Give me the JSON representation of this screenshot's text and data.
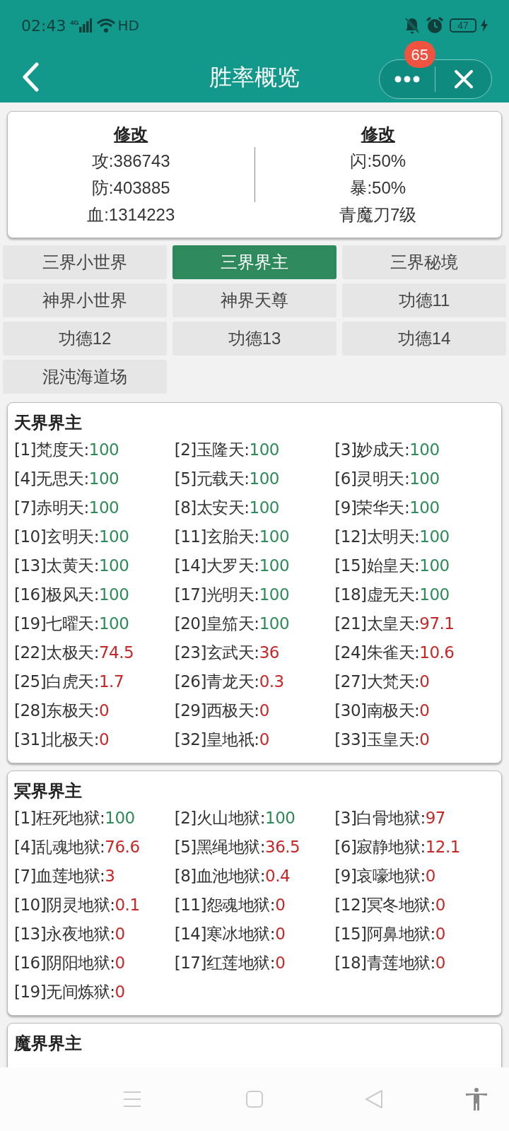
{
  "status_bar": {
    "time": "02:43",
    "network": "4G",
    "wifi_label": "HD",
    "battery": "47"
  },
  "header": {
    "title": "胜率概览",
    "badge": "65"
  },
  "stats": [
    {
      "link": "修改",
      "lines": [
        "攻:386743",
        "防:403885",
        "血:1314223"
      ]
    },
    {
      "link": "修改",
      "lines": [
        "闪:50%",
        "暴:50%",
        "青魔刀7级"
      ]
    }
  ],
  "tabs": [
    {
      "label": "三界小世界",
      "selected": false
    },
    {
      "label": "三界界主",
      "selected": true
    },
    {
      "label": "三界秘境",
      "selected": false
    },
    {
      "label": "神界小世界",
      "selected": false
    },
    {
      "label": "神界天尊",
      "selected": false
    },
    {
      "label": "功德11",
      "selected": false
    },
    {
      "label": "功德12",
      "selected": false
    },
    {
      "label": "功德13",
      "selected": false
    },
    {
      "label": "功德14",
      "selected": false
    },
    {
      "label": "混沌海道场",
      "selected": false
    }
  ],
  "sections": [
    {
      "title": "天界界主",
      "items": [
        {
          "label": "[1]梵度天:",
          "value": "100",
          "color": "#2e8b57"
        },
        {
          "label": "[2]玉隆天:",
          "value": "100",
          "color": "#2e8b57"
        },
        {
          "label": "[3]妙成天:",
          "value": "100",
          "color": "#2e8b57"
        },
        {
          "label": "[4]无思天:",
          "value": "100",
          "color": "#2e8b57"
        },
        {
          "label": "[5]元载天:",
          "value": "100",
          "color": "#2e8b57"
        },
        {
          "label": "[6]灵明天:",
          "value": "100",
          "color": "#2e8b57"
        },
        {
          "label": "[7]赤明天:",
          "value": "100",
          "color": "#2e8b57"
        },
        {
          "label": "[8]太安天:",
          "value": "100",
          "color": "#2e8b57"
        },
        {
          "label": "[9]荣华天:",
          "value": "100",
          "color": "#2e8b57"
        },
        {
          "label": "[10]玄明天:",
          "value": "100",
          "color": "#2e8b57"
        },
        {
          "label": "[11]玄胎天:",
          "value": "100",
          "color": "#2e8b57"
        },
        {
          "label": "[12]太明天:",
          "value": "100",
          "color": "#2e8b57"
        },
        {
          "label": "[13]太黄天:",
          "value": "100",
          "color": "#2e8b57"
        },
        {
          "label": "[14]大罗天:",
          "value": "100",
          "color": "#2e8b57"
        },
        {
          "label": "[15]始皇天:",
          "value": "100",
          "color": "#2e8b57"
        },
        {
          "label": "[16]极风天:",
          "value": "100",
          "color": "#2e8b57"
        },
        {
          "label": "[17]光明天:",
          "value": "100",
          "color": "#2e8b57"
        },
        {
          "label": "[18]虚无天:",
          "value": "100",
          "color": "#2e8b57"
        },
        {
          "label": "[19]七曜天:",
          "value": "100",
          "color": "#2e8b57"
        },
        {
          "label": "[20]皇笳天:",
          "value": "100",
          "color": "#2e8b57"
        },
        {
          "label": "[21]太皇天:",
          "value": "97.1",
          "color": "#c62828"
        },
        {
          "label": "[22]太极天:",
          "value": "74.5",
          "color": "#c62828"
        },
        {
          "label": "[23]玄武天:",
          "value": "36",
          "color": "#c62828"
        },
        {
          "label": "[24]朱雀天:",
          "value": "10.6",
          "color": "#c62828"
        },
        {
          "label": "[25]白虎天:",
          "value": "1.7",
          "color": "#c62828"
        },
        {
          "label": "[26]青龙天:",
          "value": "0.3",
          "color": "#c62828"
        },
        {
          "label": "[27]大梵天:",
          "value": "0",
          "color": "#c62828"
        },
        {
          "label": "[28]东极天:",
          "value": "0",
          "color": "#c62828"
        },
        {
          "label": "[29]西极天:",
          "value": "0",
          "color": "#c62828"
        },
        {
          "label": "[30]南极天:",
          "value": "0",
          "color": "#c62828"
        },
        {
          "label": "[31]北极天:",
          "value": "0",
          "color": "#c62828"
        },
        {
          "label": "[32]皇地祇:",
          "value": "0",
          "color": "#c62828"
        },
        {
          "label": "[33]玉皇天:",
          "value": "0",
          "color": "#c62828"
        }
      ]
    },
    {
      "title": "冥界界主",
      "items": [
        {
          "label": "[1]枉死地狱:",
          "value": "100",
          "color": "#2e8b57"
        },
        {
          "label": "[2]火山地狱:",
          "value": "100",
          "color": "#2e8b57"
        },
        {
          "label": "[3]白骨地狱:",
          "value": "97",
          "color": "#c62828"
        },
        {
          "label": "[4]乱魂地狱:",
          "value": "76.6",
          "color": "#c62828"
        },
        {
          "label": "[5]黑绳地狱:",
          "value": "36.5",
          "color": "#c62828"
        },
        {
          "label": "[6]寂静地狱:",
          "value": "12.1",
          "color": "#c62828"
        },
        {
          "label": "[7]血莲地狱:",
          "value": "3",
          "color": "#c62828"
        },
        {
          "label": "[8]血池地狱:",
          "value": "0.4",
          "color": "#c62828"
        },
        {
          "label": "[9]哀嚎地狱:",
          "value": "0",
          "color": "#c62828"
        },
        {
          "label": "[10]阴灵地狱:",
          "value": "0.1",
          "color": "#c62828"
        },
        {
          "label": "[11]怨魂地狱:",
          "value": "0",
          "color": "#c62828"
        },
        {
          "label": "[12]冥冬地狱:",
          "value": "0",
          "color": "#c62828"
        },
        {
          "label": "[13]永夜地狱:",
          "value": "0",
          "color": "#c62828"
        },
        {
          "label": "[14]寒冰地狱:",
          "value": "0",
          "color": "#c62828"
        },
        {
          "label": "[15]阿鼻地狱:",
          "value": "0",
          "color": "#c62828"
        },
        {
          "label": "[16]阴阳地狱:",
          "value": "0",
          "color": "#c62828"
        },
        {
          "label": "[17]红莲地狱:",
          "value": "0",
          "color": "#c62828"
        },
        {
          "label": "[18]青莲地狱:",
          "value": "0",
          "color": "#c62828"
        },
        {
          "label": "[19]无间炼狱:",
          "value": "0",
          "color": "#c62828"
        }
      ]
    },
    {
      "title": "魔界界主"
    }
  ]
}
